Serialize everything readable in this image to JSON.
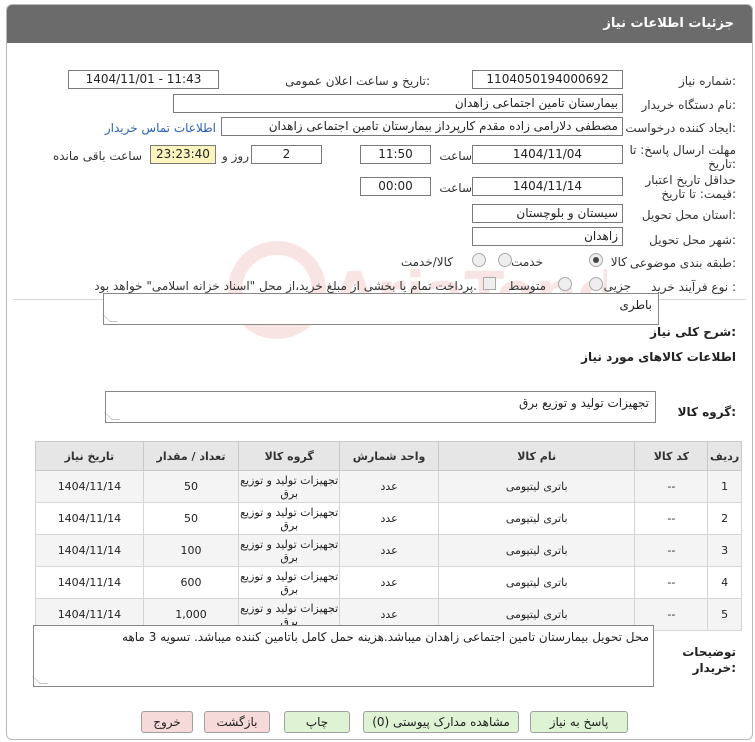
{
  "header": {
    "title": "جزئیات اطلاعات نیاز"
  },
  "fields": {
    "need_number": {
      "label": "شماره نیاز:",
      "value": "1104050194000692"
    },
    "announce_datetime": {
      "label": "تاریخ و ساعت اعلان عمومی:",
      "value": "1404/11/01 - 11:43"
    },
    "buyer_org": {
      "label": "نام دستگاه خریدار:",
      "value": "بیمارستان تامین اجتماعی زاهدان"
    },
    "requester": {
      "label": "ایجاد کننده درخواست:",
      "value": "مصطفی دلارامی زاده مقدم کارپرداز بیمارستان تامین اجتماعی زاهدان",
      "contact_link": "اطلاعات تماس خریدار"
    },
    "deadline": {
      "label_line1": "مهلت ارسال پاسخ: تا",
      "label_line2": "تاریخ:",
      "date": "1404/11/04",
      "time_label": "ساعت",
      "time": "11:50",
      "days": "2",
      "days_label": "روز و",
      "remaining": "23:23:40",
      "remaining_label": "ساعت باقی مانده"
    },
    "price_validity": {
      "label_line1": "حداقل تاریخ اعتبار",
      "label_line2": "قیمت: تا تاریخ:",
      "date": "1404/11/14",
      "time_label": "ساعت",
      "time": "00:00"
    },
    "province": {
      "label": "استان محل تحویل:",
      "value": "سیستان و بلوچستان"
    },
    "city": {
      "label": "شهر محل تحویل:",
      "value": "زاهدان"
    },
    "category": {
      "label": "طبقه بندی موضوعی:",
      "options": [
        "کالا",
        "خدمت",
        "کالا/خدمت"
      ]
    },
    "process": {
      "label": "نوع فرآیند خرید :",
      "options": [
        "جزیی",
        "متوسط"
      ],
      "note": "پرداخت تمام یا بخشی از مبلغ خرید،از محل \"اسناد خزانه اسلامی\" خواهد بود."
    }
  },
  "general_desc": {
    "label": "شرح کلی نیاز:",
    "value": "باطری"
  },
  "goods_info": {
    "label": "اطلاعات کالاهای مورد نیاز"
  },
  "goods_group": {
    "label": "گروه کالا:",
    "value": "تجهیزات تولید و توزیع برق"
  },
  "table": {
    "headers": [
      "ردیف",
      "کد کالا",
      "نام کالا",
      "واحد شمارش",
      "گروه کالا",
      "تعداد / مقدار",
      "تاریخ نیاز"
    ],
    "rows": [
      [
        "1",
        "--",
        "باتری لیتیومی",
        "عدد",
        "تجهیزات تولید و توزیع برق",
        "50",
        "1404/11/14"
      ],
      [
        "2",
        "--",
        "باتری لیتیومی",
        "عدد",
        "تجهیزات تولید و توزیع برق",
        "50",
        "1404/11/14"
      ],
      [
        "3",
        "--",
        "باتری لیتیومی",
        "عدد",
        "تجهیزات تولید و توزیع برق",
        "100",
        "1404/11/14"
      ],
      [
        "4",
        "--",
        "باتری لیتیومی",
        "عدد",
        "تجهیزات تولید و توزیع برق",
        "600",
        "1404/11/14"
      ],
      [
        "5",
        "--",
        "باتری لیتیومی",
        "عدد",
        "تجهیزات تولید و توزیع برق",
        "1,000",
        "1404/11/14"
      ]
    ]
  },
  "buyer_notes": {
    "label_line1": "توضیحات",
    "label_line2": "خریدار:",
    "value": "محل تحویل بیمارستان تامین اجتماعی زاهدان میباشد.هزینه حمل کامل باتامین کننده میباشد. تسویه 3 ماهه"
  },
  "buttons": {
    "reply": "پاسخ به نیاز",
    "docs": "مشاهده مدارک پیوستی (0)",
    "print": "چاپ",
    "back": "بازگشت",
    "exit": "خروج"
  },
  "watermark": "AriaTender.neT"
}
